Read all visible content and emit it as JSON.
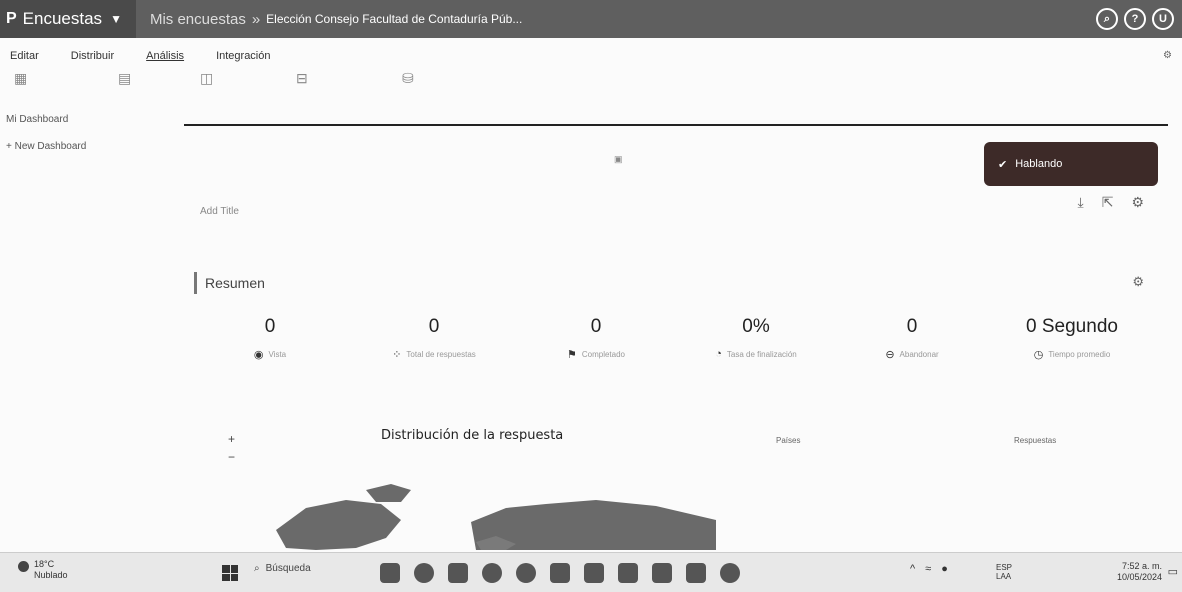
{
  "header": {
    "brand_logo": "P",
    "brand_label": "Encuestas",
    "breadcrumb_root": "Mis encuestas",
    "breadcrumb_sep": "»",
    "breadcrumb_current": "Elección Consejo Facultad de Contaduría Púb..."
  },
  "menu": {
    "items": [
      "Editar",
      "Distribuir",
      "Análisis",
      "Integración"
    ],
    "active_index": 2
  },
  "sidebar": {
    "items": [
      "Mi Dashboard",
      "+ New Dashboard"
    ]
  },
  "main": {
    "hablando_label": "Hablando",
    "add_title": "Add Title",
    "resumen_label": "Resumen",
    "stats": [
      {
        "value": "0",
        "label": "Vista",
        "icon": "eye-icon"
      },
      {
        "value": "0",
        "label": "Total de respuestas",
        "icon": "grid-icon"
      },
      {
        "value": "0",
        "label": "Completado",
        "icon": "flag-icon"
      },
      {
        "value": "0%",
        "label": "Tasa de finalización",
        "icon": "percent-icon"
      },
      {
        "value": "0",
        "label": "Abandonar",
        "icon": "stop-icon"
      },
      {
        "value": "0 Segundo",
        "label": "Tiempo promedio",
        "icon": "clock-icon"
      }
    ],
    "map_title": "Distribución de la respuesta",
    "table": {
      "col1": "Países",
      "col2": "Respuestas"
    }
  },
  "taskbar": {
    "weather_temp": "18°C",
    "weather_label": "Nublado",
    "search_label": "Búsqueda",
    "lang_top": "ESP",
    "lang_bottom": "LAA",
    "time": "7:52 a. m.",
    "date": "10/05/2024"
  },
  "colors": {
    "topbar": "#5f5f5f",
    "hablando_bg": "#3d2a28"
  }
}
